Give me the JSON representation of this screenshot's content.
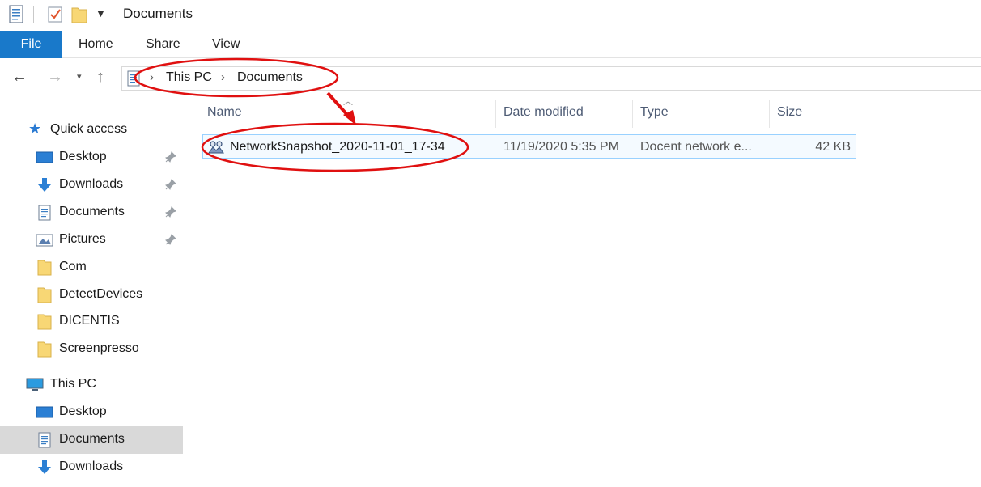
{
  "window": {
    "title": "Documents"
  },
  "quick_access_toolbar": {
    "icons": [
      "properties-icon",
      "checkbox-icon",
      "new-folder-icon",
      "customize-dropdown-icon"
    ]
  },
  "ribbon": {
    "tabs": [
      {
        "label": "File",
        "active": true
      },
      {
        "label": "Home"
      },
      {
        "label": "Share"
      },
      {
        "label": "View"
      }
    ]
  },
  "address": {
    "crumbs": [
      "This PC",
      "Documents"
    ]
  },
  "columns": {
    "name": "Name",
    "date": "Date modified",
    "type": "Type",
    "size": "Size"
  },
  "files": [
    {
      "name": "NetworkSnapshot_2020-11-01_17-34",
      "date": "11/19/2020 5:35 PM",
      "type": "Docent network e...",
      "size": "42 KB"
    }
  ],
  "nav": {
    "quick_access": "Quick access",
    "pinned": [
      {
        "label": "Desktop",
        "icon": "desktop-icon"
      },
      {
        "label": "Downloads",
        "icon": "downloads-icon"
      },
      {
        "label": "Documents",
        "icon": "documents-icon"
      },
      {
        "label": "Pictures",
        "icon": "pictures-icon"
      }
    ],
    "folders": [
      "Com",
      "DetectDevices",
      "DICENTIS",
      "Screenpresso"
    ],
    "this_pc": "This PC",
    "this_pc_items": [
      {
        "label": "Desktop",
        "icon": "desktop-icon"
      },
      {
        "label": "Documents",
        "icon": "documents-icon",
        "selected": true
      },
      {
        "label": "Downloads",
        "icon": "downloads-icon"
      }
    ]
  },
  "colors": {
    "accent": "#1979ca",
    "selection": "#d9d9d9",
    "annotation": "#e01010",
    "folder": "#f8d775"
  }
}
